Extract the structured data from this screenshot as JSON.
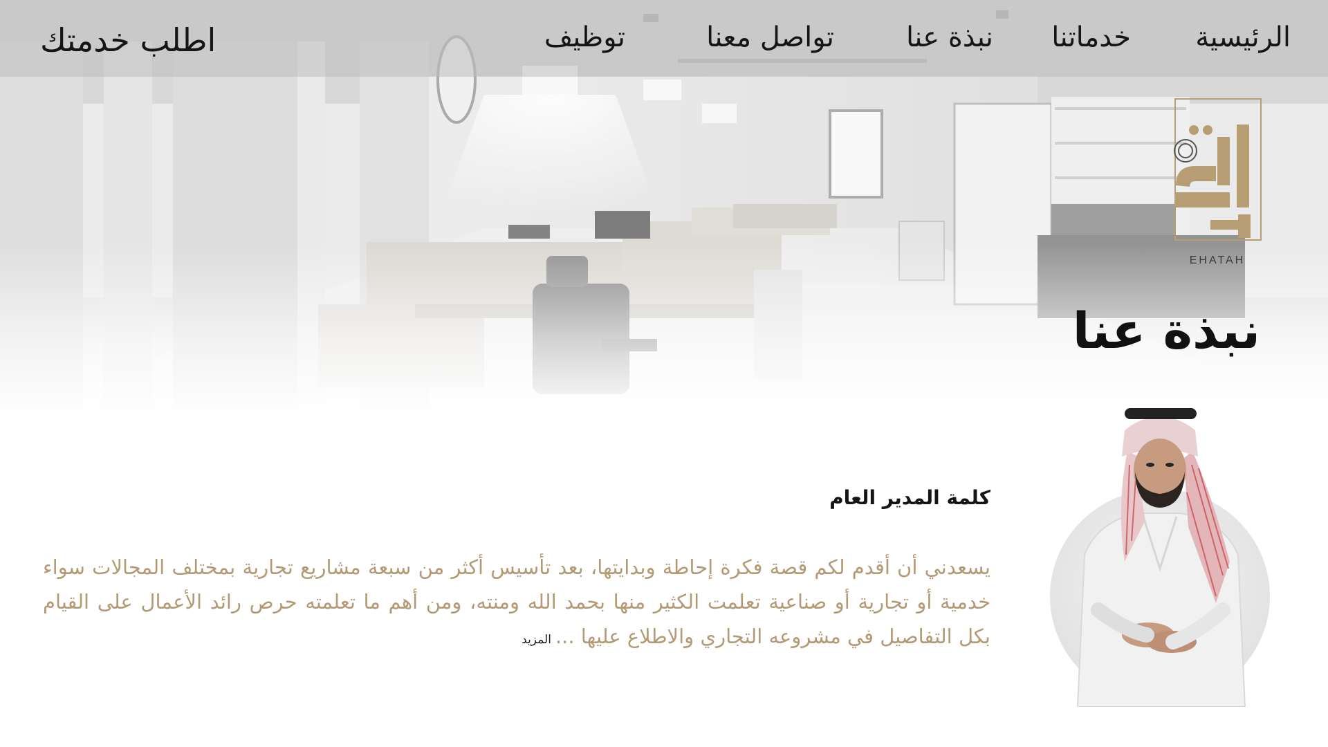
{
  "nav": {
    "home": "الرئيسية",
    "services": "خدماتنا",
    "about": "نبذة عنا",
    "contact": "تواصل معنا",
    "jobs": "توظيف",
    "request_service": "اطلب خدمتك"
  },
  "logo": {
    "name_en": "EHATAH",
    "name_ar": "إحاطة",
    "color": "#b79d74"
  },
  "hero": {
    "title": "نبذة عنا",
    "background": "office-interior-photo"
  },
  "ceo": {
    "heading": "كلمة المدير العام",
    "message": "يسعدني أن أقدم لكم قصة فكرة إحاطة وبدايتها، بعد تأسيس أكثر من سبعة مشاريع تجارية بمختلف المجالات سواء خدمية أو تجارية أو صناعية تعلمت الكثير منها بحمد الله ومنته، ومن أهم ما تعلمته حرص رائد الأعمال على القيام بكل التفاصيل في مشروعه التجاري والاطلاع عليها ...",
    "more_label": "المزيد",
    "text_color": "#b39a74"
  }
}
